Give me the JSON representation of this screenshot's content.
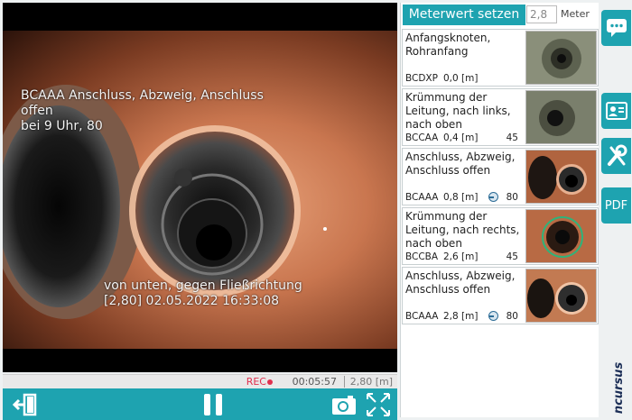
{
  "video": {
    "overlay_line1": "BCAAA Anschluss, Abzweig, Anschluss\noffen\nbei 9 Uhr, 80",
    "overlay_line2": "von unten, gegen Fließrichtung\n[2,80]   02.05.2022 16:33:08"
  },
  "status": {
    "rec_label": "REC",
    "rec_time": "00:05:57",
    "meter": "2,80 [m]"
  },
  "toolbar": {
    "exit_icon": "exit-icon",
    "pause_icon": "pause-icon",
    "camera_icon": "camera-icon",
    "fullscreen_icon": "fullscreen-icon"
  },
  "meter": {
    "button_label": "Meterwert setzen",
    "input_value": "2,8",
    "unit_label": "Meter"
  },
  "observations": [
    {
      "desc": "Anfangsknoten, Rohranfang",
      "code": "BCDXP",
      "dist": "0,0 [m]",
      "clock": false,
      "val": ""
    },
    {
      "desc": "Krümmung der Leitung, nach links, nach oben",
      "code": "BCCAA",
      "dist": "0,4 [m]",
      "clock": false,
      "val": "45"
    },
    {
      "desc": "Anschluss, Abzweig, Anschluss offen",
      "code": "BCAAA",
      "dist": "0,8 [m]",
      "clock": true,
      "val": "80"
    },
    {
      "desc": "Krümmung der Leitung, nach rechts, nach oben",
      "code": "BCCBA",
      "dist": "2,6 [m]",
      "clock": false,
      "val": "45"
    },
    {
      "desc": "Anschluss, Abzweig, Anschluss offen",
      "code": "BCAAA",
      "dist": "2,8 [m]",
      "clock": true,
      "val": "80"
    }
  ],
  "side": {
    "pdf_label": "PDF",
    "logo_text": "ncursus"
  },
  "colors": {
    "accent": "#1ea3b0",
    "rec": "#e0304e"
  }
}
